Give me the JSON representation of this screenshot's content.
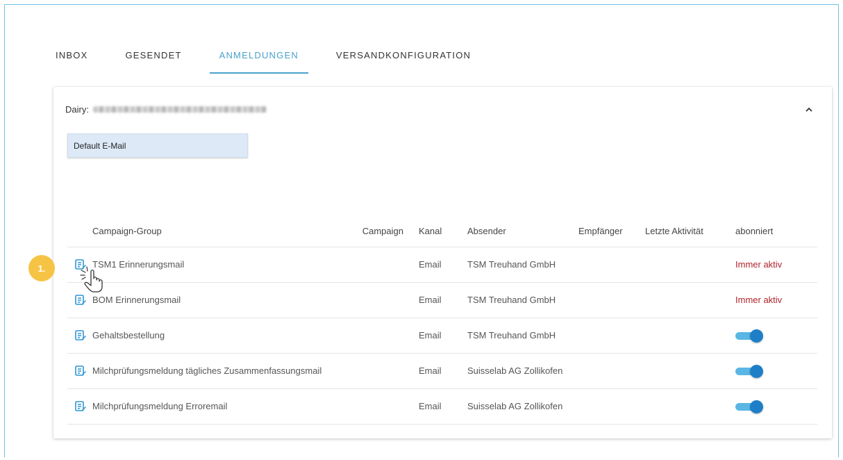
{
  "tabs": [
    {
      "label": "INBOX",
      "active": false
    },
    {
      "label": "GESENDET",
      "active": false
    },
    {
      "label": "ANMELDUNGEN",
      "active": true
    },
    {
      "label": "VERSANDKONFIGURATION",
      "active": false
    }
  ],
  "card": {
    "dairy_label": "Dairy:",
    "dropdown_value": "Default E-Mail"
  },
  "table": {
    "headers": [
      "Campaign-Group",
      "Campaign",
      "Kanal",
      "Absender",
      "Empfänger",
      "Letzte Aktivität",
      "abonniert"
    ],
    "rows": [
      {
        "group": "TSM1 Erinnerungsmail",
        "campaign": "",
        "kanal": "Email",
        "absender": "TSM Treuhand GmbH",
        "empfaenger": "",
        "letzte": "",
        "abonniert": "Immer aktiv"
      },
      {
        "group": "BOM Erinnerungsmail",
        "campaign": "",
        "kanal": "Email",
        "absender": "TSM Treuhand GmbH",
        "empfaenger": "",
        "letzte": "",
        "abonniert": "Immer aktiv"
      },
      {
        "group": "Gehaltsbestellung",
        "campaign": "",
        "kanal": "Email",
        "absender": "TSM Treuhand GmbH",
        "empfaenger": "",
        "letzte": "",
        "abonniert": "toggle-on"
      },
      {
        "group": "Milchprüfungsmeldung tägliches Zusammenfassungsmail",
        "campaign": "",
        "kanal": "Email",
        "absender": "Suisselab AG Zollikofen",
        "empfaenger": "",
        "letzte": "",
        "abonniert": "toggle-on"
      },
      {
        "group": "Milchprüfungsmeldung Erroremail",
        "campaign": "",
        "kanal": "Email",
        "absender": "Suisselab AG Zollikofen",
        "empfaenger": "",
        "letzte": "",
        "abonniert": "toggle-on"
      }
    ]
  },
  "annotation": {
    "step_label": "1."
  },
  "icons": {
    "row_icon": "edit-document-icon",
    "collapse": "chevron-up-icon",
    "pointer": "hand-pointer-icon"
  },
  "colors": {
    "accent": "#4aa0cc",
    "immer_aktiv": "#b0232a",
    "toggle": "#1e7fc8",
    "step_badge": "#f6c445",
    "dropdown_bg": "#dde9f7"
  }
}
